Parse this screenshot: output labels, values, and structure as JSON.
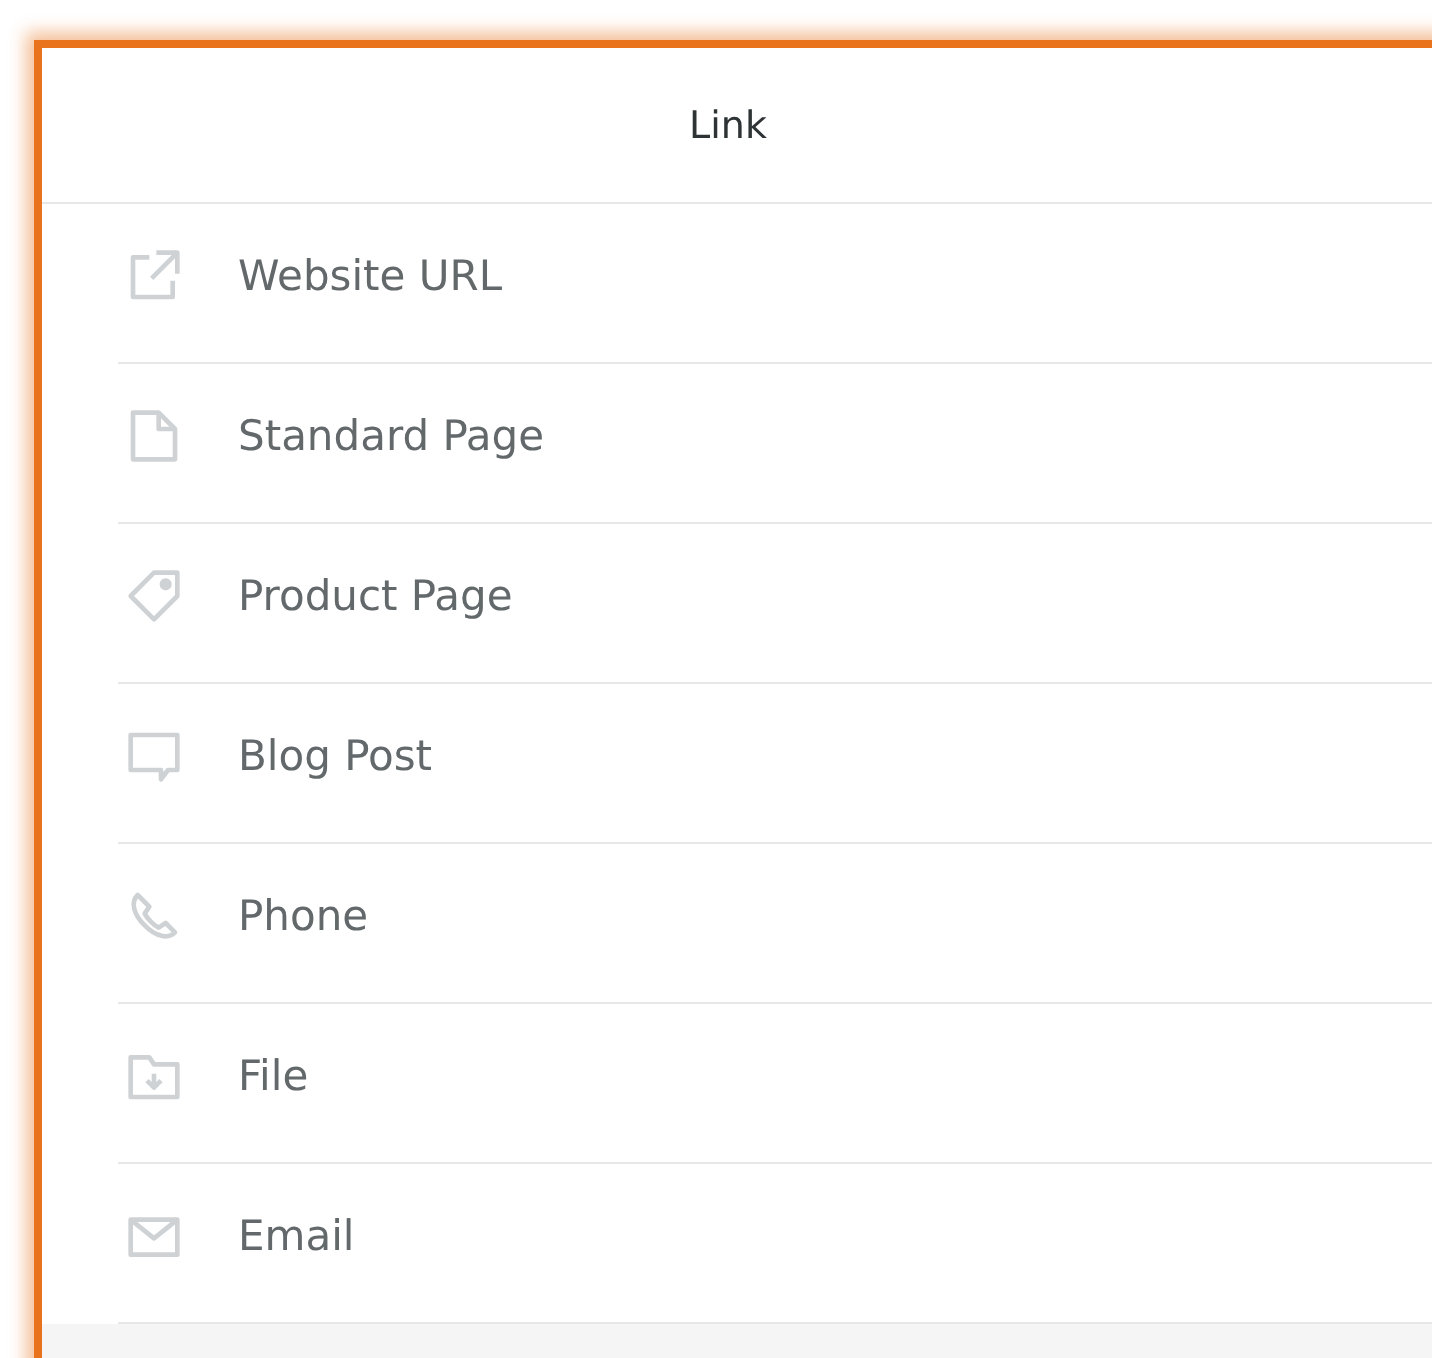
{
  "panel": {
    "title": "Link"
  },
  "items": [
    {
      "label": "Website URL",
      "kind": "external"
    },
    {
      "label": "Standard Page",
      "kind": "page"
    },
    {
      "label": "Product Page",
      "kind": "tag"
    },
    {
      "label": "Blog Post",
      "kind": "comment"
    },
    {
      "label": "Phone",
      "kind": "phone"
    },
    {
      "label": "File",
      "kind": "folder"
    },
    {
      "label": "Email",
      "kind": "mail"
    }
  ]
}
